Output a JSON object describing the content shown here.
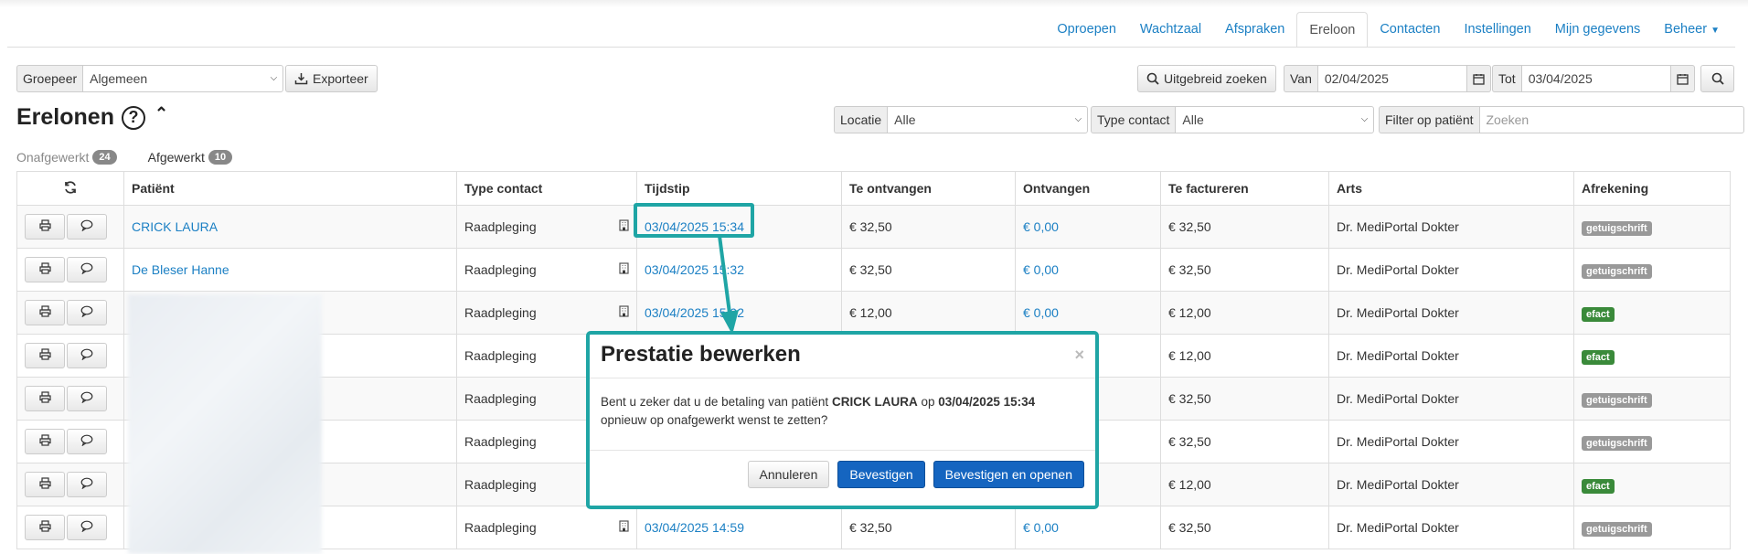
{
  "nav": {
    "tabs": [
      {
        "label": "Oproepen"
      },
      {
        "label": "Wachtzaal"
      },
      {
        "label": "Afspraken"
      },
      {
        "label": "Ereloon"
      },
      {
        "label": "Contacten"
      },
      {
        "label": "Instellingen"
      },
      {
        "label": "Mijn gegevens"
      },
      {
        "label": "Beheer"
      }
    ],
    "active": "Ereloon"
  },
  "toolbar": {
    "groepeer_label": "Groepeer",
    "groepeer_value": "Algemeen",
    "exporteer_label": "Exporteer",
    "uitgebreid_label": "Uitgebreid zoeken",
    "van_label": "Van",
    "van_value": "02/04/2025",
    "tot_label": "Tot",
    "tot_value": "03/04/2025"
  },
  "filters": {
    "locatie_label": "Locatie",
    "locatie_value": "Alle",
    "type_label": "Type contact",
    "type_value": "Alle",
    "patient_label": "Filter op patiënt",
    "patient_placeholder": "Zoeken"
  },
  "page": {
    "title": "Erelonen",
    "tabs": [
      {
        "label": "Onafgewerkt",
        "count": "24"
      },
      {
        "label": "Afgewerkt",
        "count": "10"
      }
    ]
  },
  "table": {
    "headers": [
      "Patiënt",
      "Type contact",
      "Tijdstip",
      "Te ontvangen",
      "Ontvangen",
      "Te factureren",
      "Arts",
      "Afrekening"
    ],
    "rows": [
      {
        "patient": "CRICK LAURA",
        "type": "Raadpleging",
        "time": "03/04/2025 15:34",
        "due": "€ 32,50",
        "received": "€ 0,00",
        "invoice": "€ 32,50",
        "doctor": "Dr. MediPortal Dokter",
        "settle": "getuigschrift"
      },
      {
        "patient": "De Bleser Hanne",
        "type": "Raadpleging",
        "time": "03/04/2025 15:32",
        "due": "€ 32,50",
        "received": "€ 0,00",
        "invoice": "€ 32,50",
        "doctor": "Dr. MediPortal Dokter",
        "settle": "getuigschrift"
      },
      {
        "patient": "",
        "type": "Raadpleging",
        "time": "03/04/2025 15:02",
        "due": "€ 12,00",
        "received": "€ 0,00",
        "invoice": "€ 12,00",
        "doctor": "Dr. MediPortal Dokter",
        "settle": "efact"
      },
      {
        "patient": "",
        "type": "Raadpleging",
        "time": "",
        "due": "",
        "received": "",
        "invoice": "€ 12,00",
        "doctor": "Dr. MediPortal Dokter",
        "settle": "efact"
      },
      {
        "patient": "",
        "type": "Raadpleging",
        "time": "",
        "due": "",
        "received": "",
        "invoice": "€ 32,50",
        "doctor": "Dr. MediPortal Dokter",
        "settle": "getuigschrift"
      },
      {
        "patient": "",
        "type": "Raadpleging",
        "time": "",
        "due": "",
        "received": "",
        "invoice": "€ 32,50",
        "doctor": "Dr. MediPortal Dokter",
        "settle": "getuigschrift"
      },
      {
        "patient": "",
        "type": "Raadpleging",
        "time": "",
        "due": "",
        "received": "",
        "invoice": "€ 12,00",
        "doctor": "Dr. MediPortal Dokter",
        "settle": "efact"
      },
      {
        "patient": "",
        "type": "Raadpleging",
        "time": "03/04/2025 14:59",
        "due": "€ 32,50",
        "received": "€ 0,00",
        "invoice": "€ 32,50",
        "doctor": "Dr. MediPortal Dokter",
        "settle": "getuigschrift"
      }
    ]
  },
  "modal": {
    "title": "Prestatie bewerken",
    "close": "×",
    "text_1": "Bent u zeker dat u de betaling van patiënt",
    "patient": "CRICK LAURA",
    "text_2": "op",
    "time": "03/04/2025 15:34",
    "text_3": "opnieuw op onafgewerkt wenst te zetten?",
    "cancel": "Annuleren",
    "confirm": "Bevestigen",
    "confirm_open": "Bevestigen en openen"
  },
  "colors": {
    "link": "#1c80c4",
    "highlight": "#1fa5a5",
    "primary": "#1565c0",
    "tag_grey": "#999999",
    "tag_green": "#3a8a3a"
  }
}
